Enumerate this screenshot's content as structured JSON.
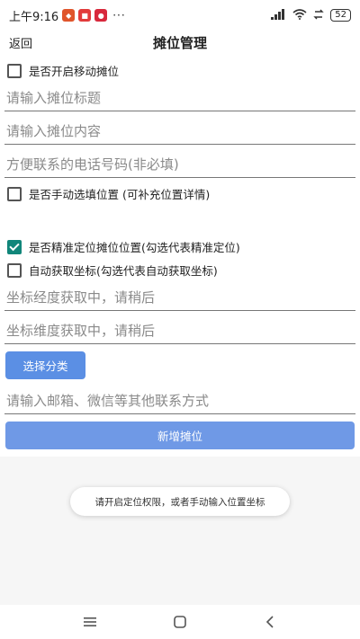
{
  "status_bar": {
    "time": "上午9:16",
    "dots": "···",
    "signal": "5G",
    "battery": "52"
  },
  "header": {
    "back": "返回",
    "title": "摊位管理"
  },
  "form": {
    "mobile_stall_label": "是否开启移动摊位",
    "mobile_stall_checked": false,
    "title_placeholder": "请输入摊位标题",
    "content_placeholder": "请输入摊位内容",
    "phone_placeholder": "方便联系的电话号码(非必填)",
    "manual_location_label": "是否手动选填位置 (可补充位置详情)",
    "manual_location_checked": false,
    "precise_location_label": "是否精准定位摊位位置(勾选代表精准定位)",
    "precise_location_checked": true,
    "auto_coords_label": "自动获取坐标(勾选代表自动获取坐标)",
    "auto_coords_checked": false,
    "longitude_placeholder": "坐标经度获取中，请稍后",
    "latitude_placeholder": "坐标维度获取中，请稍后",
    "category_button": "选择分类",
    "contact_placeholder": "请输入邮箱、微信等其他联系方式",
    "add_button": "新增摊位"
  },
  "toast": "请开启定位权限，或者手动输入位置坐标",
  "colors": {
    "primary": "#5b8fe4",
    "checked": "#11867a"
  }
}
